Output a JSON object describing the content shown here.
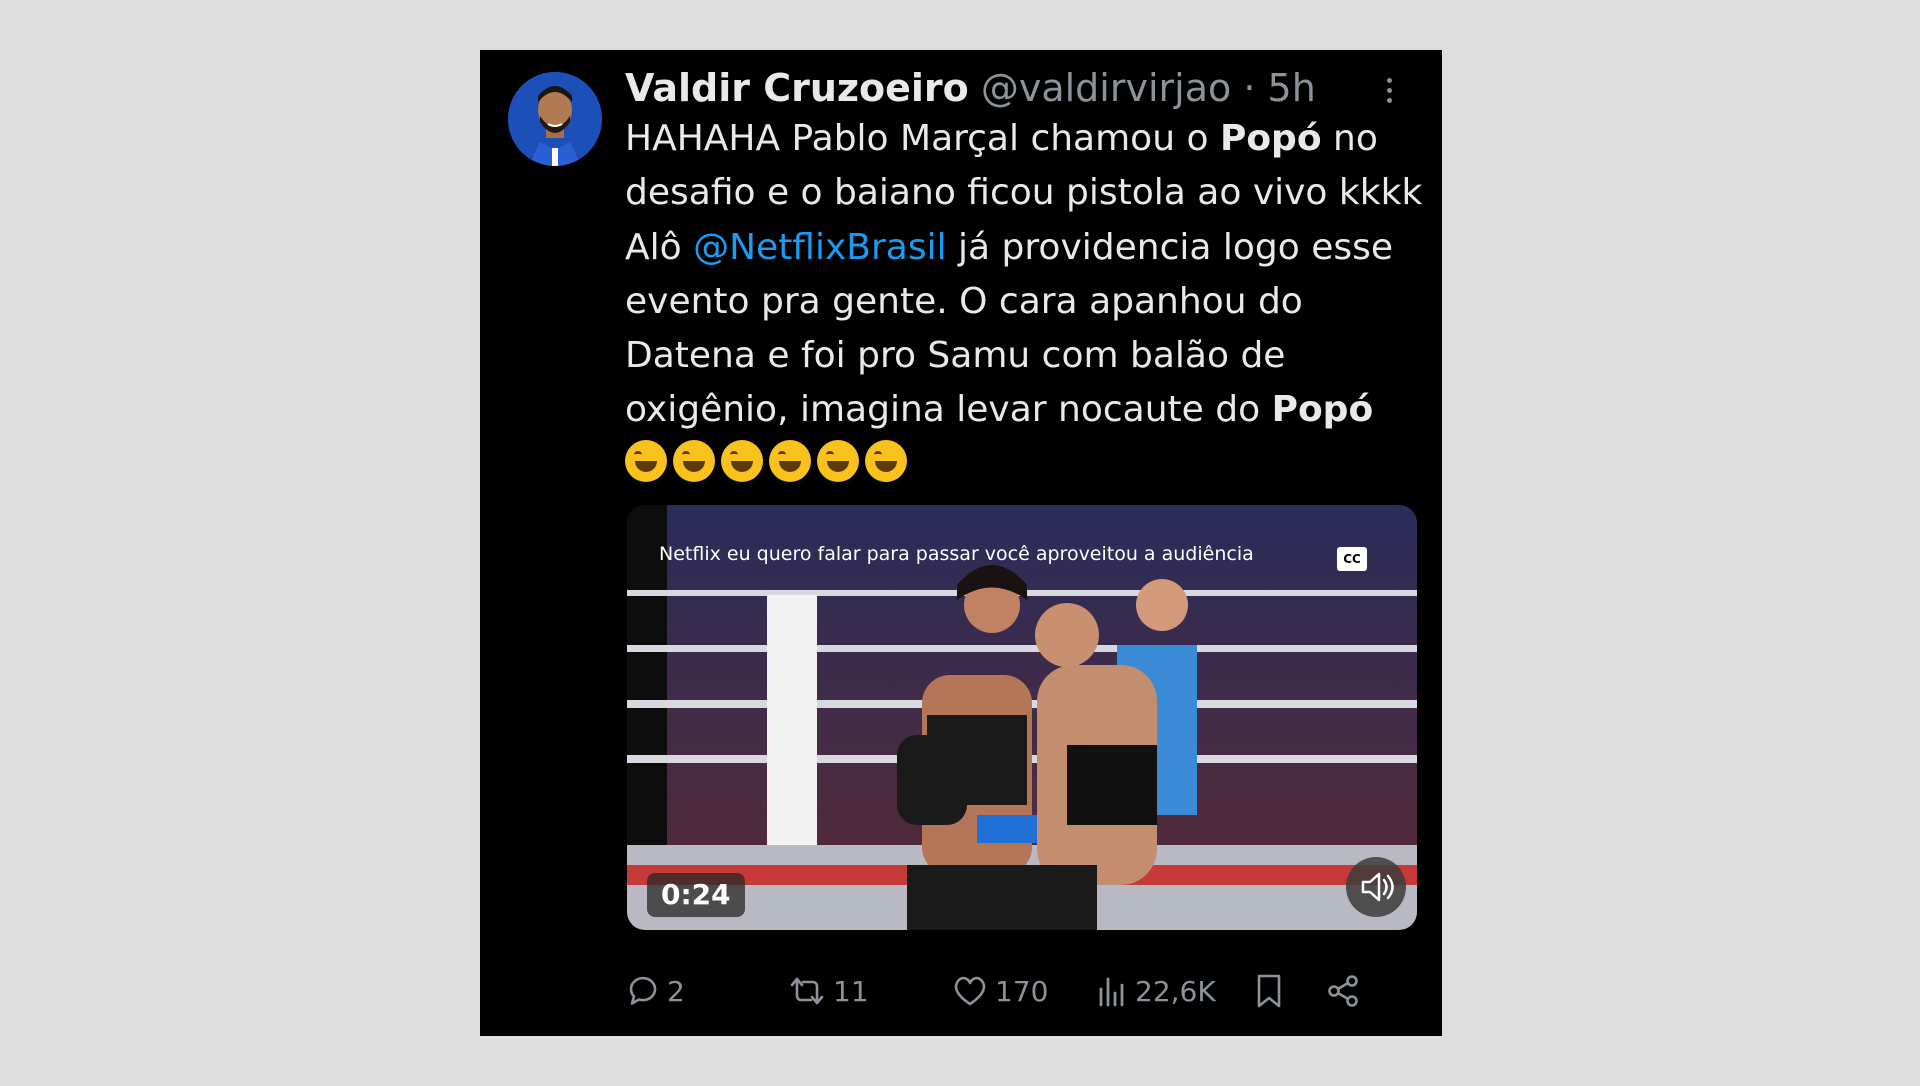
{
  "tweet": {
    "author_name": "Valdir Cruzoeiro",
    "handle": "@valdirvirjao",
    "separator": "·",
    "time": "5h",
    "text": {
      "p1": "HAHAHA Pablo Marçal chamou o ",
      "bold1": "Popó",
      "p2": " no desafio e o baiano ficou pistola ao vivo kkkk Alô ",
      "mention": "@NetflixBrasil",
      "p3": " já providencia logo esse evento pra gente. O cara apanhou do Datena e foi pro Samu com balão de oxigênio, imagina levar nocaute do ",
      "bold2": "Popó"
    },
    "emoji_count": 6
  },
  "video": {
    "caption": "Netflix eu quero falar para passar você aproveitou a audiência",
    "cc_label": "CC",
    "duration": "0:24"
  },
  "actions": {
    "replies": "2",
    "reposts": "11",
    "likes": "170",
    "views": "22,6K"
  },
  "colors": {
    "background": "#000000",
    "text": "#e7e9ea",
    "muted": "#8b9299",
    "link": "#1d9bf0"
  }
}
